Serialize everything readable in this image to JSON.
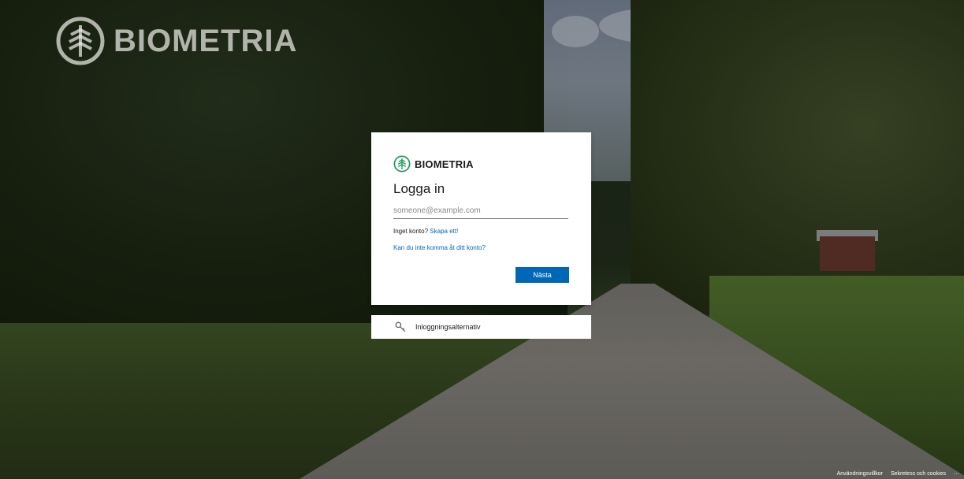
{
  "background": {
    "description_colors": {
      "accent": "#0067b8"
    }
  },
  "brand": {
    "name": "BIOMETRIA",
    "icon": "biometria-tree-logo-icon"
  },
  "signin": {
    "logo_text": "BIOMETRIA",
    "title": "Logga in",
    "email": {
      "value": "",
      "placeholder": "someone@example.com"
    },
    "no_account_text": "Inget konto?",
    "create_account_link": "Skapa ett!",
    "cant_access_link": "Kan du inte komma åt ditt konto?",
    "next_button": "Nästa"
  },
  "options": {
    "icon": "key-icon",
    "label": "Inloggningsalternativ"
  },
  "footer": {
    "terms": "Användningsvillkor",
    "privacy": "Sekretess och cookies",
    "more": "···"
  }
}
